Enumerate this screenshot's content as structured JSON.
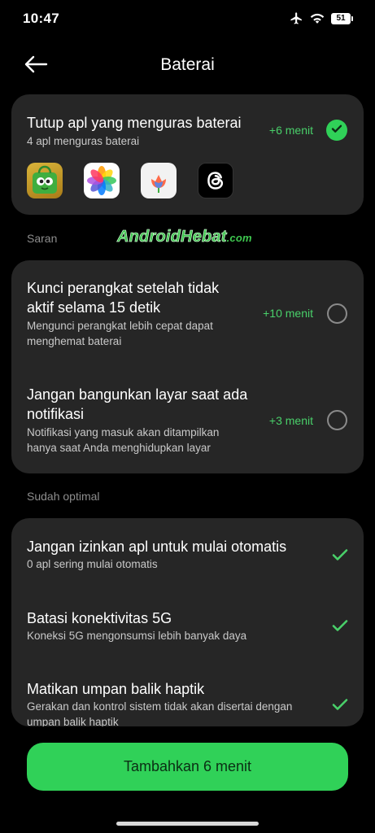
{
  "status_bar": {
    "time": "10:47",
    "battery_level": "51",
    "icons": [
      "airplane-icon",
      "wifi-icon",
      "battery-icon"
    ]
  },
  "header": {
    "title": "Baterai",
    "back_icon": "arrow-left-icon"
  },
  "close_apps": {
    "title": "Tutup apl yang menguras baterai",
    "subtitle": "4 apl menguras baterai",
    "gain": "+6 menit",
    "checked": true,
    "apps": [
      "shop-app-icon",
      "photos-app-icon",
      "tulip-app-icon",
      "threads-app-icon"
    ]
  },
  "watermark": {
    "text": "AndroidHebat",
    "suffix": ".com"
  },
  "saran": {
    "label": "Saran",
    "items": [
      {
        "title_line1": "Kunci perangkat setelah tidak",
        "title_line2": "aktif selama 15 detik",
        "sub_line1": "Mengunci perangkat lebih cepat dapat",
        "sub_line2": "menghemat baterai",
        "gain": "+10 menit",
        "checked": false
      },
      {
        "title_line1": "Jangan bangunkan layar saat ada",
        "title_line2": "notifikasi",
        "sub_line1": "Notifikasi yang masuk akan ditampilkan",
        "sub_line2": "hanya saat Anda menghidupkan layar",
        "gain": "+3 menit",
        "checked": false
      }
    ]
  },
  "optimal": {
    "label": "Sudah optimal",
    "items": [
      {
        "title": "Jangan izinkan apl untuk mulai otomatis",
        "sub_line1": "0 apl sering mulai otomatis",
        "sub_line2": ""
      },
      {
        "title": "Batasi konektivitas 5G",
        "sub_line1": "Koneksi 5G mengonsumsi lebih banyak daya",
        "sub_line2": ""
      },
      {
        "title": "Matikan umpan balik haptik",
        "sub_line1": "Gerakan dan kontrol sistem tidak akan disertai dengan",
        "sub_line2": "umpan balik haptik"
      }
    ]
  },
  "bottom_button": {
    "label": "Tambahkan 6 menit"
  },
  "colors": {
    "accent": "#30d158",
    "gain_text": "#49d06a",
    "card_bg": "#262626",
    "background": "#000000"
  }
}
